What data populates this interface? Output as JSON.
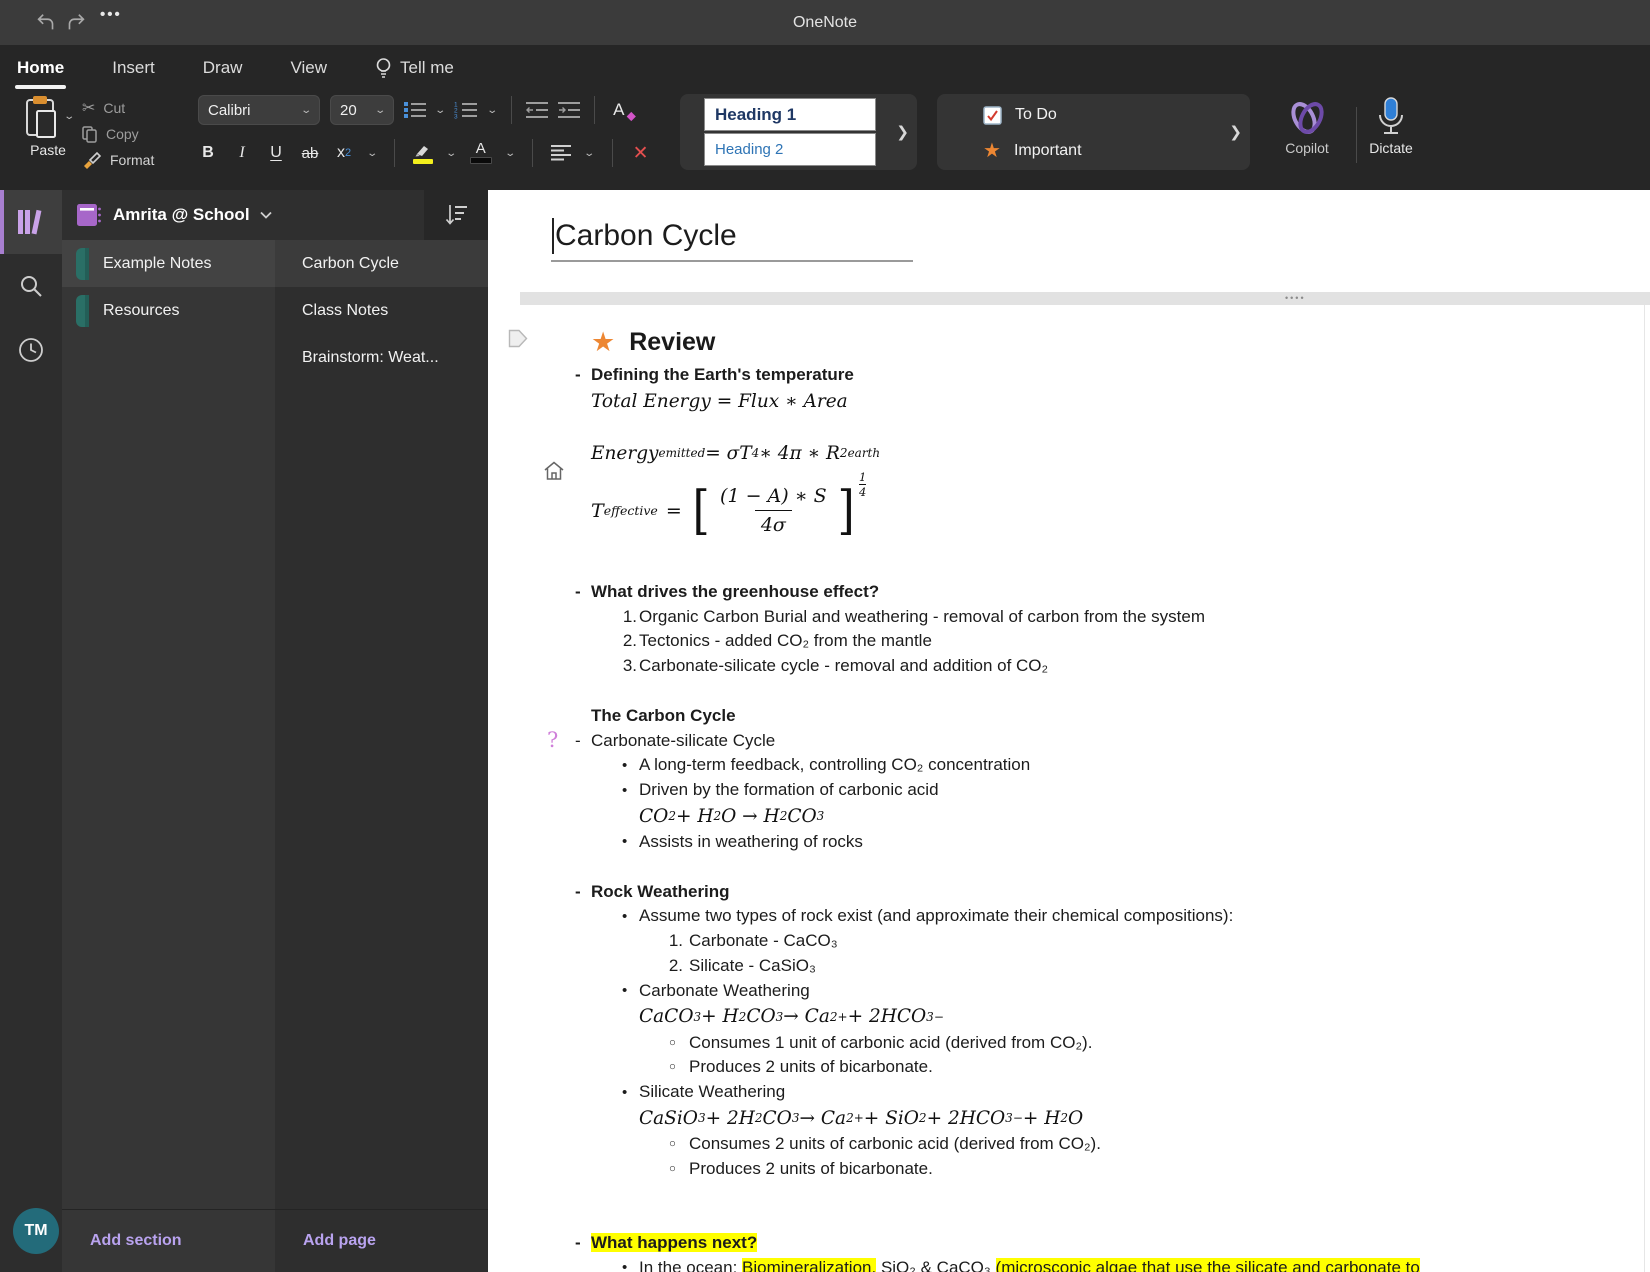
{
  "titlebar": {
    "app_title": "OneNote",
    "ellipsis": "•••"
  },
  "ribbon": {
    "tabs": [
      {
        "label": "Home",
        "active": true
      },
      {
        "label": "Insert",
        "active": false
      },
      {
        "label": "Draw",
        "active": false
      },
      {
        "label": "View",
        "active": false
      },
      {
        "label": "Tell me",
        "active": false,
        "icon": "lightbulb"
      }
    ],
    "clipboard": {
      "paste": "Paste",
      "cut": "Cut",
      "copy": "Copy",
      "format": "Format"
    },
    "font": {
      "family": "Calibri",
      "size": "20"
    },
    "text_buttons": {
      "bold": "B",
      "italic": "I",
      "underline": "U",
      "strike": "ab",
      "subscript_base": "x"
    },
    "styles": [
      {
        "label": "Heading 1"
      },
      {
        "label": "Heading 2"
      }
    ],
    "tags": [
      {
        "label": "To Do",
        "icon": "checkbox"
      },
      {
        "label": "Important",
        "icon": "star"
      }
    ],
    "copilot_label": "Copilot",
    "dictate_label": "Dictate"
  },
  "notebook": {
    "title": "Amrita @ School",
    "sections": [
      {
        "label": "Example Notes",
        "active": true
      },
      {
        "label": "Resources",
        "active": false
      }
    ],
    "pages": [
      {
        "label": "Carbon Cycle",
        "active": true
      },
      {
        "label": "Class Notes",
        "active": false
      },
      {
        "label": "Brainstorm: Weat...",
        "active": false
      }
    ],
    "add_section": "Add section",
    "add_page": "Add page",
    "avatar_initials": "TM"
  },
  "page": {
    "title": "Carbon Cycle",
    "review_heading": "Review",
    "teff": {
      "lhs": "T",
      "lhs_sub": "effective",
      "eq": "=",
      "numerator": "(1 − A) ∗ S",
      "denominator": "4σ",
      "exp_num": "1",
      "exp_den": "4"
    },
    "lines": [
      {
        "type": "dash",
        "text": "Defining the Earth's temperature",
        "bold": true
      },
      {
        "type": "math",
        "eq": "Total Energy = Flux ∗ Area",
        "indent": 0
      },
      {
        "type": "gap"
      },
      {
        "type": "math",
        "eq": "Energy_{emitted} = σT^{4} ∗ 4π ∗ R^{2}_{earth}",
        "indent": 0
      },
      {
        "type": "teff",
        "margin_icon": "home-icon"
      },
      {
        "type": "gap"
      },
      {
        "type": "dash",
        "text": "What drives the greenhouse effect?",
        "bold": true
      },
      {
        "type": "num",
        "n": "1.",
        "text": "Organic Carbon Burial and weathering - removal of carbon from the system",
        "indent": 1
      },
      {
        "type": "num",
        "n": "2.",
        "text": "Tectonics - added CO₂ from the mantle",
        "indent": 1
      },
      {
        "type": "num",
        "n": "3.",
        "text": "Carbonate-silicate cycle - removal and addition of CO₂",
        "indent": 1
      },
      {
        "type": "gap"
      },
      {
        "type": "boldline",
        "text": "The Carbon Cycle",
        "bold": true
      },
      {
        "type": "dash",
        "text": "Carbonate-silicate Cycle",
        "bold": false,
        "margin_icon": "question-icon"
      },
      {
        "type": "bullet",
        "text": "A long-term feedback, controlling CO₂ concentration"
      },
      {
        "type": "bullet",
        "text": "Driven by the formation of carbonic acid"
      },
      {
        "type": "math",
        "eq": "CO_{2} + H_{2}O → H_{2}CO_{3}",
        "indent": 1
      },
      {
        "type": "bullet",
        "text": "Assists in weathering of rocks"
      },
      {
        "type": "gap"
      },
      {
        "type": "dash",
        "text": "Rock Weathering",
        "bold": true
      },
      {
        "type": "bullet",
        "text": "Assume two types of rock exist (and approximate their chemical compositions):"
      },
      {
        "type": "num",
        "n": "1.",
        "text": "Carbonate - CaCO₃",
        "indent": 2
      },
      {
        "type": "num",
        "n": "2.",
        "text": "Silicate - CaSiO₃",
        "indent": 2
      },
      {
        "type": "bullet",
        "text": "Carbonate Weathering"
      },
      {
        "type": "math",
        "eq": "CaCO_{3} + H_{2}CO_{3} → Ca^{2+} + 2HCO_{3}^{−}",
        "indent": 1
      },
      {
        "type": "circle",
        "text": "Consumes 1 unit of carbonic acid (derived from CO₂)."
      },
      {
        "type": "circle",
        "text": "Produces 2 units of bicarbonate."
      },
      {
        "type": "bullet",
        "text": "Silicate Weathering"
      },
      {
        "type": "math",
        "eq": "CaSiO_{3} + 2H_{2}CO_{3} → Ca^{2+} + SiO_{2} + 2HCO_{3}^{−} + H_{2}O",
        "indent": 1
      },
      {
        "type": "circle",
        "text": "Consumes 2 units of carbonic acid (derived from CO₂)."
      },
      {
        "type": "circle",
        "text": "Produces 2 units of bicarbonate."
      },
      {
        "type": "gap"
      },
      {
        "type": "gap"
      },
      {
        "type": "dash",
        "text": "What happens next?",
        "bold": true,
        "highlight": true
      },
      {
        "type": "bullet",
        "segments": [
          {
            "t": "In the ocean: "
          },
          {
            "t": "Biomineralization.",
            "hl": true
          },
          {
            "t": " SiO₂ & CaCO₃ "
          },
          {
            "t": "(microscopic algae that use the silicate and carbonate to",
            "hl": true
          }
        ]
      }
    ]
  },
  "colors": {
    "accent_purple": "#a87fd0",
    "important_star": "#ed8733",
    "highlight": "#ffff00",
    "heading1_blue": "#1f3864",
    "heading2_blue": "#2e74b5",
    "copilot_purple": "#8b63c9",
    "dictate_blue": "#2f7fd6",
    "avatar_teal": "#236b7a",
    "section_tab_teal": "#2a6f66",
    "question_tag": "#cf7fd9"
  }
}
